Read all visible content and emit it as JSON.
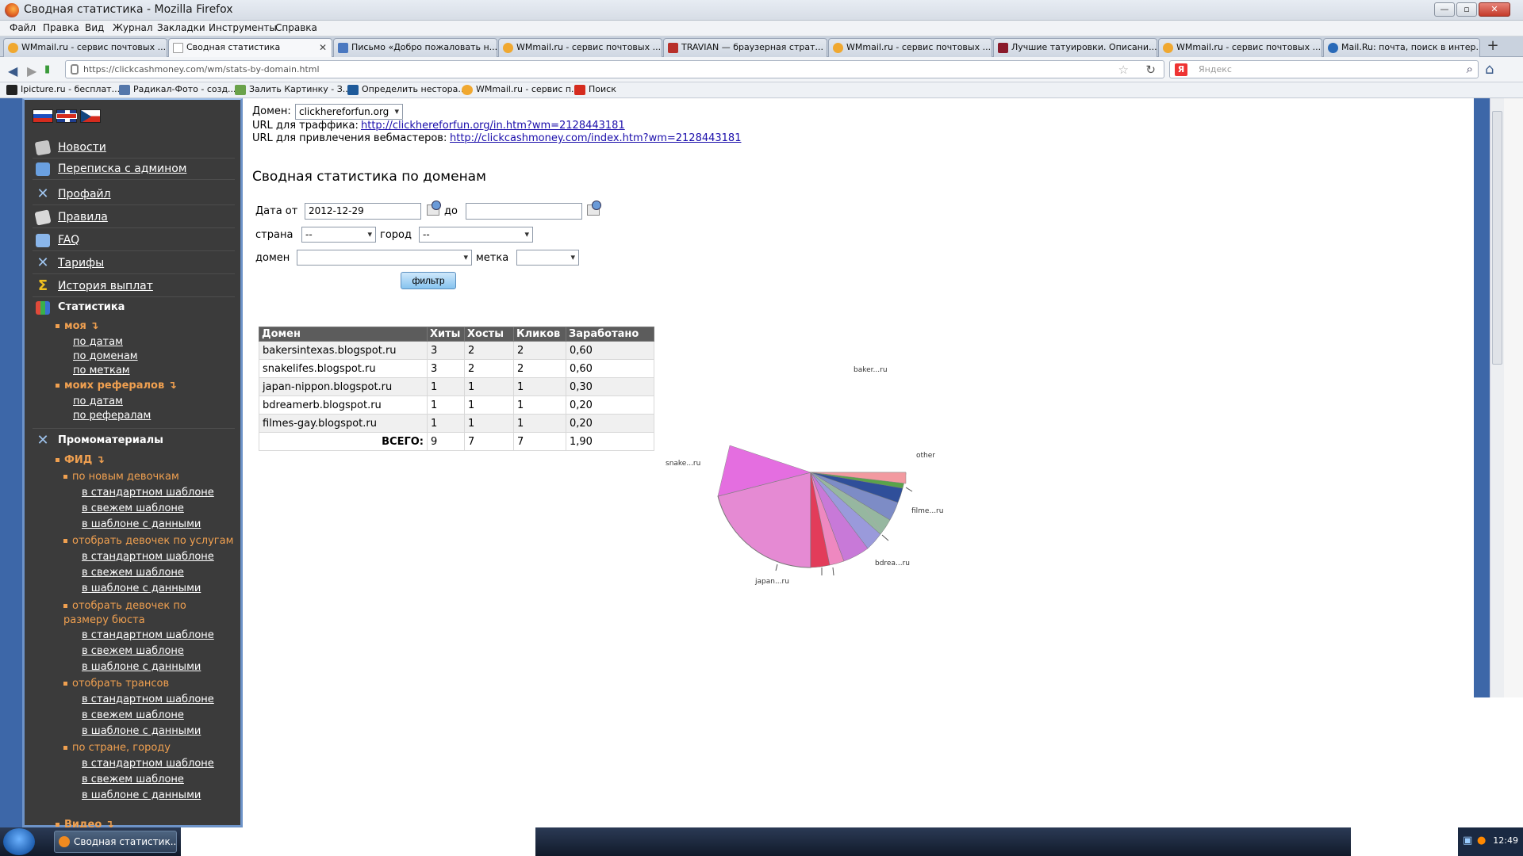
{
  "window": {
    "title": "Сводная статистика - Mozilla Firefox",
    "controls": [
      "—",
      "▫",
      "✕"
    ]
  },
  "menu": [
    "Файл",
    "Правка",
    "Вид",
    "Журнал",
    "Закладки",
    "Инструменты",
    "Справка"
  ],
  "tabs": [
    {
      "label": "WMmail.ru - сервис почтовых ...",
      "active": false
    },
    {
      "label": "Сводная статистика",
      "active": true
    },
    {
      "label": "Письмо «Добро пожаловать н...",
      "active": false
    },
    {
      "label": "WMmail.ru - сервис почтовых ...",
      "active": false
    },
    {
      "label": "TRAVIAN — браузерная страт...",
      "active": false
    },
    {
      "label": "WMmail.ru - сервис почтовых ...",
      "active": false
    },
    {
      "label": "Лучшие татуировки. Описани...",
      "active": false
    },
    {
      "label": "WMmail.ru - сервис почтовых ...",
      "active": false
    },
    {
      "label": "Mail.Ru: почта, поиск в интер...",
      "active": false
    }
  ],
  "address": {
    "url": "https://clickcashmoney.com/wm/stats-by-domain.html"
  },
  "search": {
    "placeholder": "Яндекс",
    "engine_badge": "Я"
  },
  "bookmarks": [
    "Ipicture.ru - бесплат...",
    "Радикал-Фото - созд...",
    "Залить Картинку - З...",
    "Определить нестора...",
    "WMmail.ru - сервис п...",
    "Поиск"
  ],
  "sidebar": {
    "items": [
      {
        "label": "Новости",
        "icon": "news-icon"
      },
      {
        "label": "Переписка с админом",
        "icon": "mail-icon"
      },
      {
        "label": "Профайл",
        "icon": "tools-icon"
      },
      {
        "label": "Правила",
        "icon": "rules-icon"
      },
      {
        "label": "FAQ",
        "icon": "faq-icon"
      },
      {
        "label": "Тарифы",
        "icon": "tools-icon"
      },
      {
        "label": "История выплат",
        "icon": "hourglass-icon"
      },
      {
        "label": "Статистика",
        "icon": "chart-icon"
      }
    ],
    "stats": {
      "my": "моя ↴",
      "my_links": [
        "по датам",
        "по доменам",
        "по меткам"
      ],
      "referrals": "моих рефералов ↴",
      "ref_links": [
        "по датам",
        "по рефералам"
      ]
    },
    "promo": {
      "title": "Промоматериалы",
      "feed": "ФИД ↴",
      "groups": [
        {
          "label": "по новым девочкам"
        },
        {
          "label": "отобрать девочек по услугам"
        },
        {
          "label": "отобрать девочек по размеру бюста"
        },
        {
          "label": "отобрать трансов"
        },
        {
          "label": "по стране, городу"
        }
      ],
      "templates": [
        "в стандартном шаблоне",
        "в свежем шаблоне",
        "в шаблоне с данными"
      ],
      "video": "Видео ↴"
    }
  },
  "content": {
    "domain_label": "Домен:",
    "domain_value": "clickhereforfun.org",
    "traffic_label": "URL для траффика:",
    "traffic_url": "http://clickhereforfun.org/in.htm?wm=2128443181",
    "webmaster_label": "URL для привлечения вебмастеров:",
    "webmaster_url": "http://clickcashmoney.com/index.htm?wm=2128443181",
    "heading": "Сводная статистика по доменам",
    "filter": {
      "date_from_label": "Дата от",
      "date_from": "2012-12-29",
      "date_to_label": "до",
      "date_to": "",
      "country_label": "страна",
      "country_value": "--",
      "city_label": "город",
      "city_value": "--",
      "domain_label": "домен",
      "domain_value": "",
      "tag_label": "метка",
      "tag_value": "",
      "button": "фильтр"
    },
    "table": {
      "headers": [
        "Домен",
        "Хиты",
        "Хосты",
        "Кликов",
        "Заработано"
      ],
      "rows": [
        [
          "bakersintexas.blogspot.ru",
          "3",
          "2",
          "2",
          "0,60"
        ],
        [
          "snakelifes.blogspot.ru",
          "3",
          "2",
          "2",
          "0,60"
        ],
        [
          "japan-nippon.blogspot.ru",
          "1",
          "1",
          "1",
          "0,30"
        ],
        [
          "bdreamerb.blogspot.ru",
          "1",
          "1",
          "1",
          "0,20"
        ],
        [
          "filmes-gay.blogspot.ru",
          "1",
          "1",
          "1",
          "0,20"
        ]
      ],
      "total": [
        "ВСЕГО:",
        "9",
        "7",
        "7",
        "1,90"
      ]
    }
  },
  "taskbar": {
    "item": "Сводная статистик...",
    "clock": "12:49"
  }
}
